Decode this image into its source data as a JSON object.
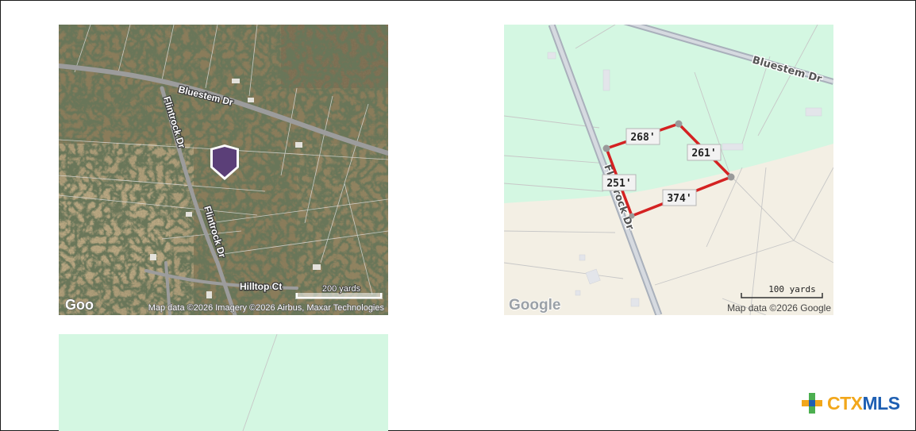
{
  "satellite_map": {
    "road_labels": [
      "Bluestem Dr",
      "Flintrock Dr",
      "Flintrock Dr",
      "Hilltop Ct"
    ],
    "scale_label": "200 yards",
    "google_logo": "Goo",
    "attribution": "Map data ©2026 Imagery ©2026 Airbus, Maxar Technologies",
    "marker_color": "#5b3f78"
  },
  "parcel_map": {
    "road_labels": [
      "Bluestem Dr",
      "Flintrock Dr"
    ],
    "dimensions": [
      "268'",
      "261'",
      "374'",
      "251'"
    ],
    "scale_label": "100 yards",
    "google_logo": "Google",
    "attribution": "Map data ©2026 Google",
    "boundary_color": "#d42222",
    "zone_colors": {
      "green": "#d4f7e2",
      "beige": "#f3efe4"
    }
  },
  "third_map": {
    "fill_color": "#d4f7e2"
  },
  "brand": {
    "part1": "CTX",
    "part2": "MLS"
  }
}
